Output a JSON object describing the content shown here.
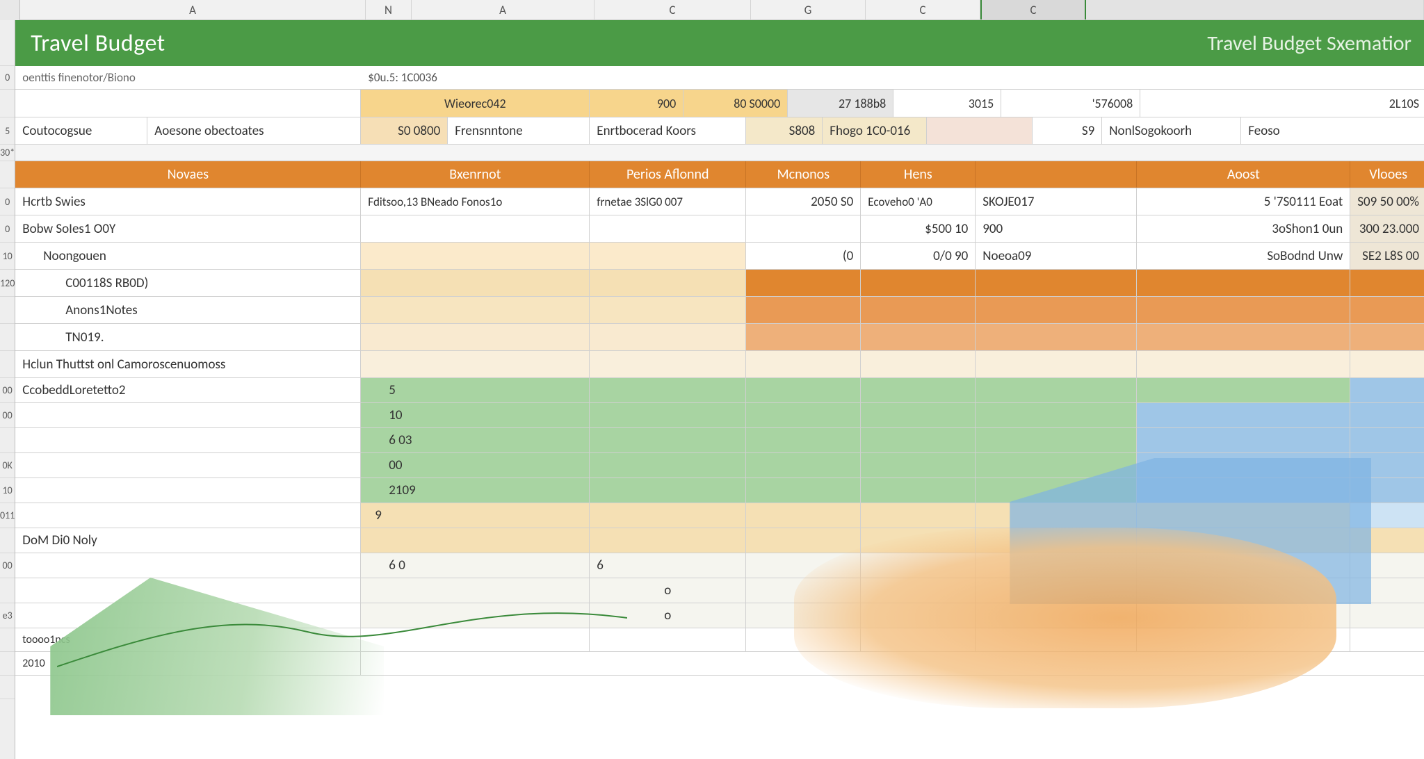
{
  "col_headers": [
    "A",
    "N",
    "A",
    "C",
    "G",
    "C",
    "C"
  ],
  "title_left": "Travel Budget",
  "title_right": "Travel Budget Sxematior",
  "meta1_left": "oenttis finenotor/Biono",
  "meta1_right": "$0u.5: 1C0036",
  "summary": {
    "c_yellow_label": "Wieorec042",
    "v1": "900",
    "v2": "80 S0000",
    "v3": "27 188b8",
    "v4": "3015",
    "v5": "'576008",
    "v6": "2L10S"
  },
  "labels": {
    "a": "Coutocogsue",
    "b": "Aoesone obectoates",
    "c": "S0 0800",
    "d": "Frensnntone",
    "e": "Enrtbocerad Koors",
    "f": "S808",
    "g": "Fhogo 1C0-016",
    "h": "S9",
    "i": "NonlSogokoorh",
    "j": "Feoso"
  },
  "thead": [
    "Novaes",
    "Bxenrnot",
    "Perios Aflonnd",
    "Mcnonos",
    "Hens",
    "Aoost",
    "Vlooes"
  ],
  "rows": [
    {
      "a": "Hcrtb  Swies",
      "b": "Fditsoo,13     BNeado Fonos1o",
      "c": "frnetae 3SlG0 007",
      "d": "2050   S0",
      "e": "Ecoveho0 'A0",
      "f": "SKOJE017",
      "g": "5 '7S0111 Eoat",
      "h": "S09 50 00%"
    },
    {
      "a": "Bobw  SoIes1 O0Y",
      "b": "",
      "c": "",
      "d": "",
      "e": "$500   10",
      "f": "900",
      "g": "3oShon1 0un",
      "h": "300 23.000"
    },
    {
      "a": "Noongouen",
      "b": "",
      "c": "",
      "d": "(0",
      "e": "0/0 90",
      "f": "Noeoa09",
      "g": "SoBodnd Unw",
      "h": "SE2 L8S 00"
    }
  ],
  "sub_rows": [
    "C00118S RB0D)",
    "Anons1Notes",
    "TN019."
  ],
  "section2": "Hclun  Thuttst onl Camoroscenuomoss",
  "grn_label": "CcobeddLoretetto2",
  "grn_vals": [
    "5",
    "10",
    "6 03",
    "00",
    "2109"
  ],
  "low1": "9",
  "low_label": "DoM Di0 Noly",
  "dot1": "6    0",
  "dot1b": "6",
  "dot2": "o",
  "dot3": "o",
  "foot1": "toooo1ncs",
  "foot2": "2010",
  "row_nums_a": [
    "0",
    "",
    "5",
    "30*",
    "",
    "0",
    "0",
    "10",
    "120",
    ""
  ],
  "row_nums_b": [
    "",
    "00",
    "00",
    "",
    "0K",
    "10",
    "011",
    "",
    "00",
    "e3",
    ""
  ]
}
